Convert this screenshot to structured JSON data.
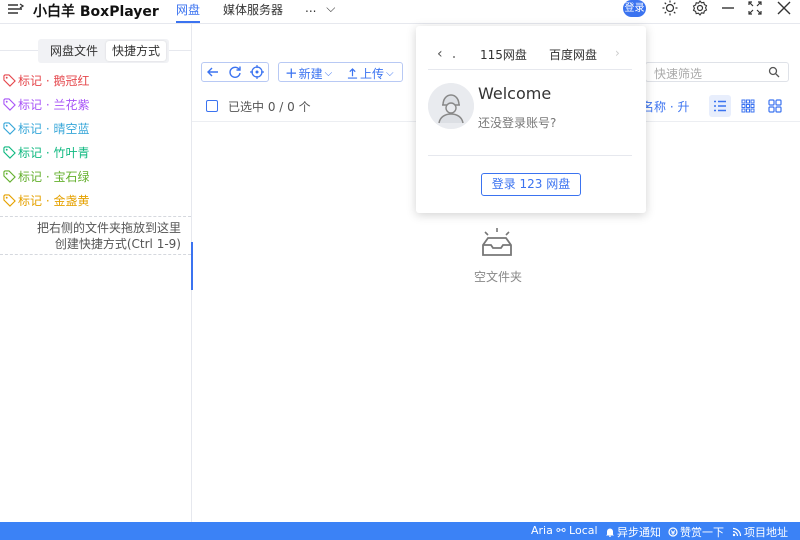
{
  "titlebar": {
    "app_title": "小白羊 BoxPlayer",
    "tabs": [
      {
        "label": "网盘",
        "active": true
      },
      {
        "label": "媒体服务器",
        "active": false
      },
      {
        "label": "...",
        "active": false
      }
    ],
    "login_badge": "登录",
    "icons": [
      "menu-icon",
      "theme-sun-icon",
      "settings-gear-icon",
      "minimize-icon",
      "maximize-icon",
      "close-icon"
    ]
  },
  "sidebar": {
    "tabs": [
      {
        "label": "网盘文件"
      },
      {
        "label": "快捷方式",
        "active": true
      }
    ],
    "tags": [
      {
        "label": "标记 · 鹅冠红",
        "color": "#e5484d"
      },
      {
        "label": "标记 · 兰花紫",
        "color": "#a855f7"
      },
      {
        "label": "标记 · 晴空蓝",
        "color": "#38a7d9"
      },
      {
        "label": "标记 · 竹叶青",
        "color": "#10b981"
      },
      {
        "label": "标记 · 宝石绿",
        "color": "#65b02f"
      },
      {
        "label": "标记 · 金盏黄",
        "color": "#e5a100"
      }
    ],
    "drop_hint_line1": "把右侧的文件夹拖放到这里",
    "drop_hint_line2": "创建快捷方式(Ctrl 1-9)"
  },
  "toolbar": {
    "new_label": "新建",
    "upload_label": "上传",
    "search_placeholder": "快速筛选"
  },
  "list": {
    "selected_text": "已选中 0 / 0 个",
    "sort_label": "名称 · 升",
    "empty_text": "空文件夹"
  },
  "popup": {
    "tabs": [
      "115网盘",
      "百度网盘"
    ],
    "welcome": "Welcome",
    "login_question": "还没登录账号?",
    "login_button": "登录 123 网盘"
  },
  "statusbar": {
    "aria": "Aria ⚯ Local",
    "notify": "异步通知",
    "donate": "赞赏一下",
    "project": "项目地址"
  },
  "colors": {
    "accent": "#3b73f0",
    "statusbar": "#3b82f6"
  }
}
